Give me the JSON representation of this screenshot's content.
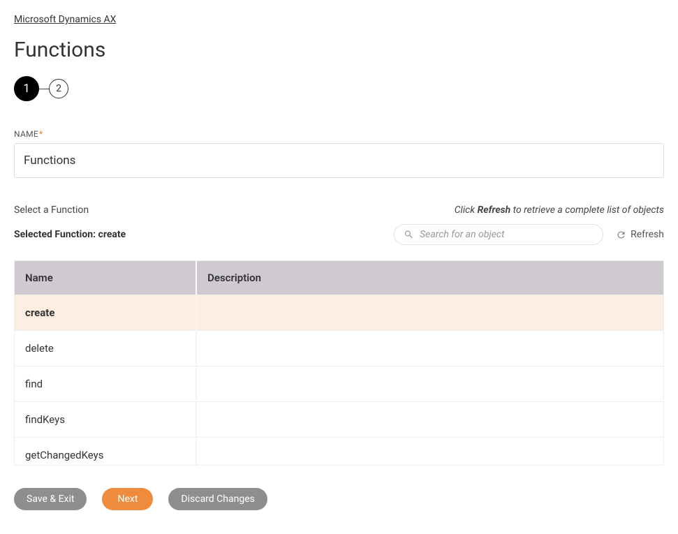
{
  "breadcrumb": "Microsoft Dynamics AX",
  "page_title": "Functions",
  "stepper": {
    "steps": [
      "1",
      "2"
    ],
    "active_index": 0
  },
  "name_field": {
    "label": "NAME",
    "required_mark": "*",
    "value": "Functions"
  },
  "select_label": "Select a Function",
  "hint": {
    "prefix": "Click ",
    "bold": "Refresh",
    "suffix": " to retrieve a complete list of objects"
  },
  "selected_fn": {
    "prefix": "Selected Function: ",
    "value": "create"
  },
  "search": {
    "placeholder": "Search for an object"
  },
  "refresh_label": "Refresh",
  "table": {
    "headers": [
      "Name",
      "Description"
    ],
    "rows": [
      {
        "name": "create",
        "description": "",
        "selected": true
      },
      {
        "name": "delete",
        "description": "",
        "selected": false
      },
      {
        "name": "find",
        "description": "",
        "selected": false
      },
      {
        "name": "findKeys",
        "description": "",
        "selected": false
      },
      {
        "name": "getChangedKeys",
        "description": "",
        "selected": false
      }
    ]
  },
  "buttons": {
    "save_exit": "Save & Exit",
    "next": "Next",
    "discard": "Discard Changes"
  }
}
